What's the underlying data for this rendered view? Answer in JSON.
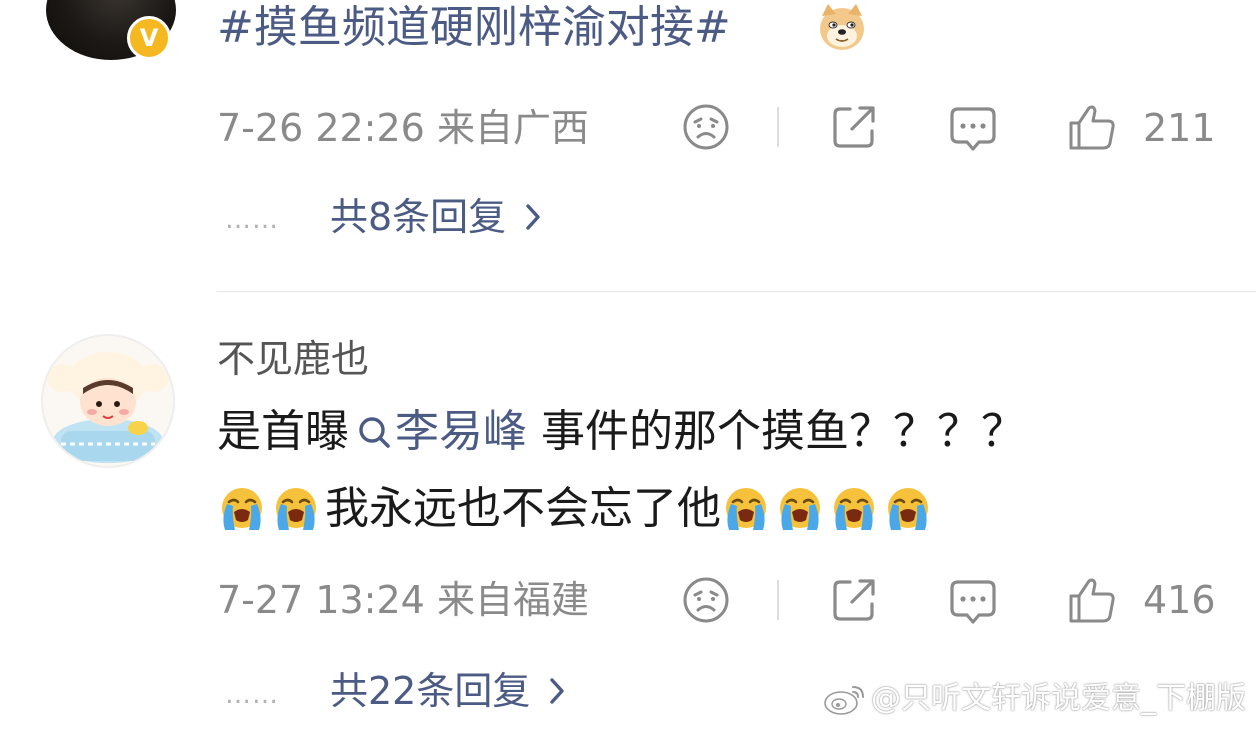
{
  "comment1": {
    "hashtag": "#摸鱼频道硬刚梓渝对接#",
    "emoji_icon": "doge-emoji-icon",
    "timestamp": "7-26 22:26",
    "location": "来自广西",
    "likes": "211",
    "replies_label": "共8条回复",
    "replies_dots": "……"
  },
  "comment2": {
    "username": "不见鹿也",
    "text_before_mention": "是首曝",
    "mention": "李易峰",
    "text_after_mention": " 事件的那个摸鱼？？？？",
    "line2_text": "我永远也不会忘了他",
    "emoji_icon": "crying-face-emoji-icon",
    "timestamp": "7-27 13:24",
    "location": "来自福建",
    "likes": "416",
    "replies_label": "共22条回复",
    "replies_dots": "……"
  },
  "watermark": "@只听文轩诉说爱意_下棚版",
  "colors": {
    "link": "#4b5b84",
    "meta": "#8a8a8a",
    "badge": "#f6b820",
    "emoji_yellow": "#f7c23b",
    "emoji_tear": "#4aa8e8"
  }
}
